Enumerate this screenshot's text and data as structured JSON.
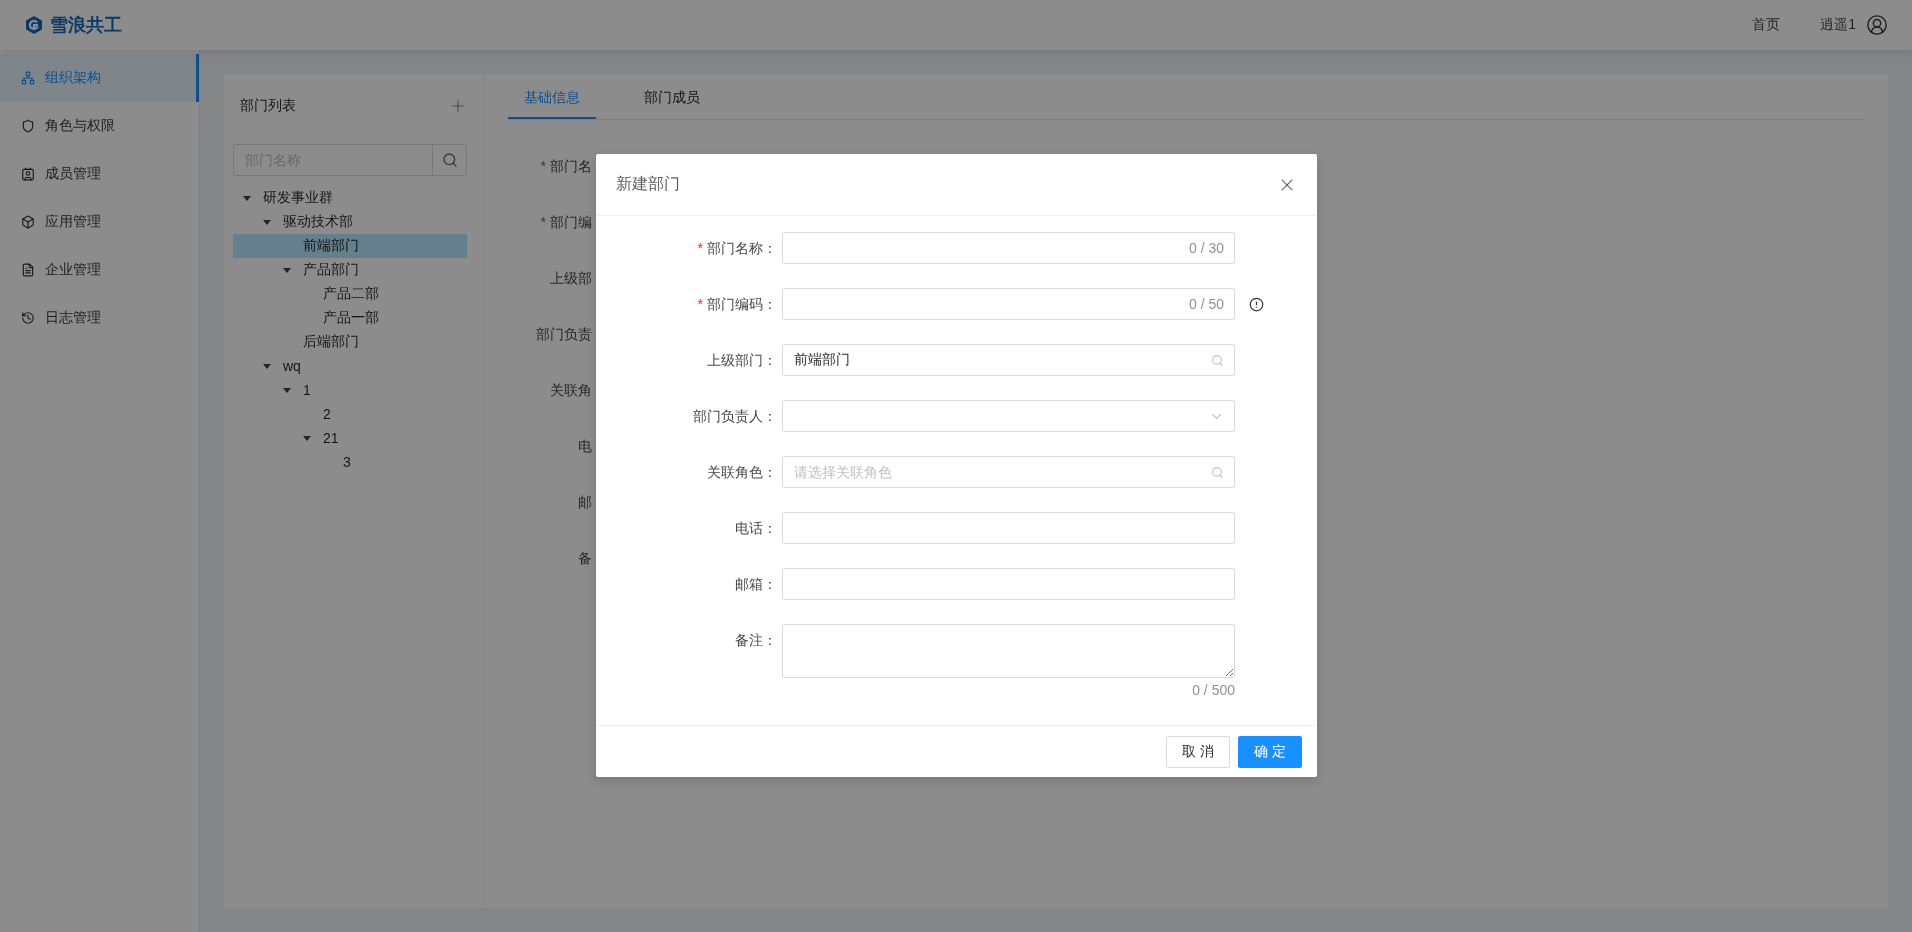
{
  "header": {
    "logo_text": "雪浪共工",
    "nav": [
      "首页"
    ],
    "user": "逍遥1"
  },
  "sidebar": {
    "items": [
      {
        "label": "组织架构",
        "selected": true
      },
      {
        "label": "角色与权限",
        "selected": false
      },
      {
        "label": "成员管理",
        "selected": false
      },
      {
        "label": "应用管理",
        "selected": false
      },
      {
        "label": "企业管理",
        "selected": false
      },
      {
        "label": "日志管理",
        "selected": false
      }
    ]
  },
  "tree": {
    "title": "部门列表",
    "search": {
      "placeholder": "部门名称"
    },
    "nodes": [
      {
        "label": "研发事业群",
        "expanded": true,
        "selected": false,
        "children": [
          {
            "label": "驱动技术部",
            "expanded": true,
            "selected": false,
            "children": [
              {
                "label": "前端部门",
                "selected": true
              },
              {
                "label": "产品部门",
                "expanded": true,
                "selected": false,
                "children": [
                  {
                    "label": "产品二部",
                    "selected": false
                  },
                  {
                    "label": "产品一部",
                    "selected": false
                  }
                ]
              },
              {
                "label": "后端部门",
                "selected": false
              }
            ]
          },
          {
            "label": "wq",
            "expanded": true,
            "selected": false,
            "children": [
              {
                "label": "1",
                "expanded": true,
                "selected": false,
                "children": [
                  {
                    "label": "2",
                    "selected": false
                  },
                  {
                    "label": "21",
                    "expanded": true,
                    "selected": false,
                    "children": [
                      {
                        "label": "3",
                        "selected": false
                      }
                    ]
                  }
                ]
              }
            ]
          }
        ]
      }
    ]
  },
  "tabs": [
    {
      "label": "基础信息",
      "selected": true
    },
    {
      "label": "部门成员",
      "selected": false
    }
  ],
  "background_form": {
    "labels": [
      {
        "label": "部门名",
        "required_mark": "*"
      },
      {
        "label": "部门编",
        "required_mark": "*"
      },
      {
        "label": "上级部"
      },
      {
        "label": "部门负责"
      },
      {
        "label": "关联角"
      },
      {
        "label": "电"
      },
      {
        "label": "邮"
      },
      {
        "label": "备"
      }
    ]
  },
  "dialog": {
    "title": "新建部门",
    "fields": [
      {
        "kind": "text",
        "label": "部门名称：",
        "required_mark": "*",
        "counter": "0 / 30",
        "warning": false
      },
      {
        "kind": "text",
        "label": "部门编码：",
        "required_mark": "*",
        "counter": "0 / 50",
        "warning": true
      },
      {
        "kind": "search",
        "label": "上级部门：",
        "value": "前端部门",
        "warning": false
      },
      {
        "kind": "select",
        "label": "部门负责人：",
        "warning": false
      },
      {
        "kind": "search",
        "label": "关联角色：",
        "placeholder": "请选择关联角色",
        "warning": false
      },
      {
        "kind": "text",
        "label": "电话：",
        "warning": false
      },
      {
        "kind": "text",
        "label": "邮箱：",
        "warning": false
      },
      {
        "kind": "textarea",
        "label": "备注：",
        "counter": "0 / 500",
        "warning": false
      }
    ],
    "buttons": {
      "cancel": "取 消",
      "ok": "确 定"
    }
  }
}
